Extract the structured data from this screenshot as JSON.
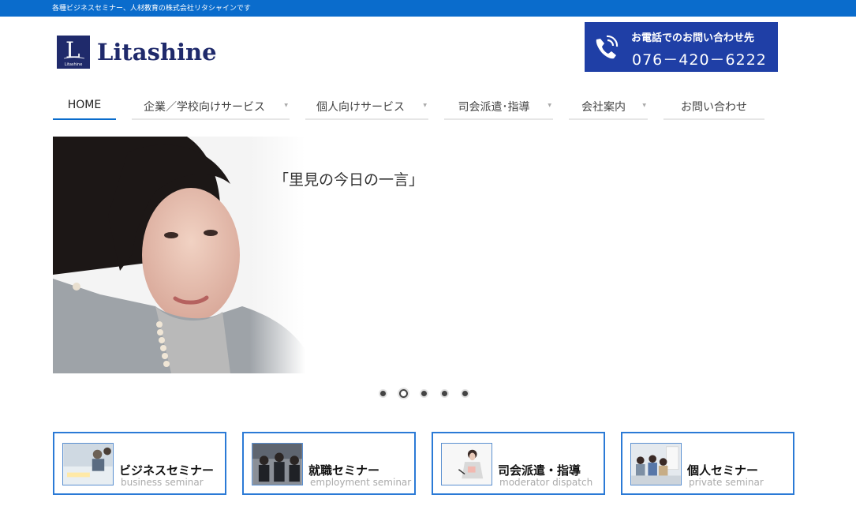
{
  "topbar": {
    "tagline": "各種ビジネスセミナー、人材教育の株式会社リタシャインです"
  },
  "logo": {
    "name": "Litashine",
    "mark_letter": "L",
    "mark_small": "Litashine"
  },
  "contact": {
    "label": "お電話でのお問い合わせ先",
    "phone": "076－420－6222",
    "icon": "phone-icon"
  },
  "nav": {
    "items": [
      {
        "label": "HOME",
        "active": true,
        "dropdown": false
      },
      {
        "label": "企業／学校向けサービス",
        "active": false,
        "dropdown": true
      },
      {
        "label": "個人向けサービス",
        "active": false,
        "dropdown": true
      },
      {
        "label": "司会派遣･指導",
        "active": false,
        "dropdown": true
      },
      {
        "label": "会社案内",
        "active": false,
        "dropdown": true
      },
      {
        "label": "お問い合わせ",
        "active": false,
        "dropdown": false
      }
    ]
  },
  "slider": {
    "quote": "「里見の今日の一言」",
    "slide_count": 5,
    "active_index": 1
  },
  "services": [
    {
      "title": "ビジネスセミナー",
      "subtitle": "business seminar"
    },
    {
      "title": "就職セミナー",
      "subtitle": "employment seminar"
    },
    {
      "title": "司会派遣・指導",
      "subtitle": "moderator dispatch"
    },
    {
      "title": "個人セミナー",
      "subtitle": "private seminar"
    }
  ],
  "colors": {
    "accent": "#0a6ccc",
    "brand": "#1f2a6b",
    "phone_bg": "#1f3fa6",
    "card_border": "#2b7ad6"
  }
}
